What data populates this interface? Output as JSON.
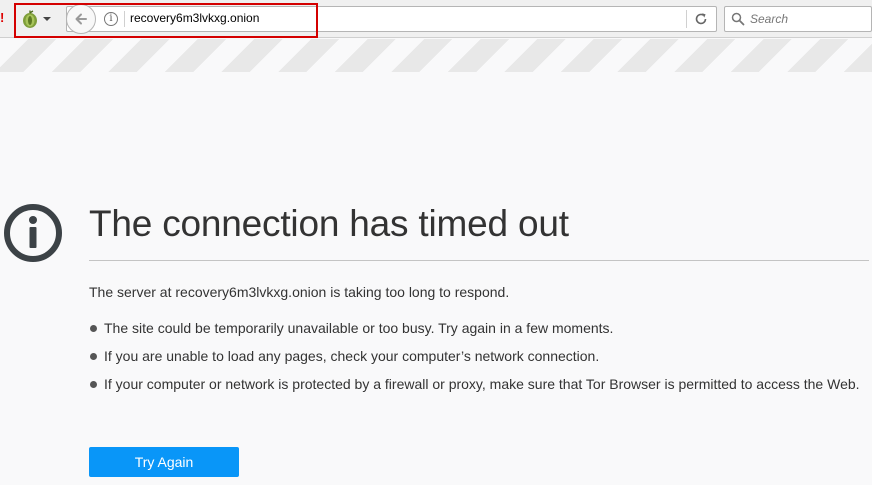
{
  "toolbar": {
    "url": "recovery6m3lvkxg.onion",
    "search_placeholder": "Search",
    "edge_mark": "!"
  },
  "error_page": {
    "title": "The connection has timed out",
    "description": "The server at recovery6m3lvkxg.onion is taking too long to respond.",
    "bullets": [
      "The site could be temporarily unavailable or too busy. Try again in a few moments.",
      "If you are unable to load any pages, check your computer’s network connection.",
      "If your computer or network is protected by a firewall or proxy, make sure that Tor Browser is permitted to access the Web."
    ],
    "button_label": "Try Again"
  },
  "colors": {
    "accent": "#0996f8",
    "highlight": "#d40000",
    "background": "#f9f9fa"
  }
}
